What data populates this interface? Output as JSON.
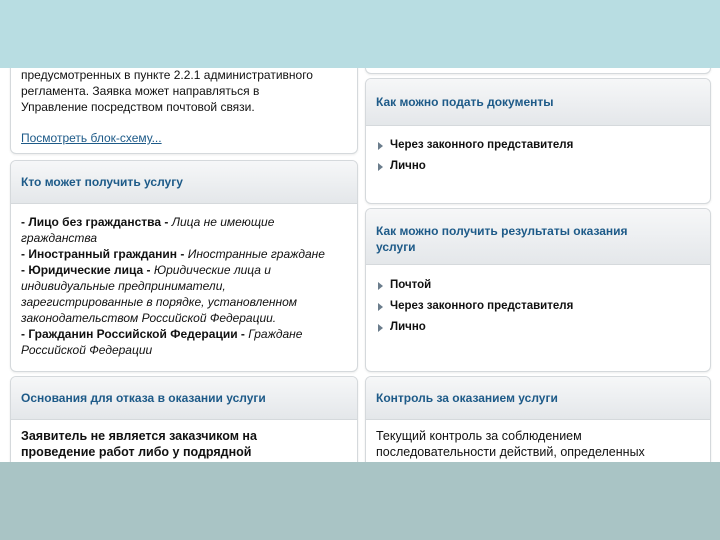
{
  "left_top": {
    "text_lines": [
      "предусмотренных в пункте 2.2.1 административного",
      "регламента. Заявка может направляться в",
      "Управление посредством почтовой связи."
    ],
    "link": "Посмотреть блок-схему..."
  },
  "who": {
    "title": "Кто может получить услугу",
    "lines": [
      {
        "b": "- Лицо без гражданства - ",
        "i": "Лица не имеющие"
      },
      {
        "b": "",
        "i": "гражданства"
      },
      {
        "b": "- Иностранный гражданин - ",
        "i": "Иностранные граждане"
      },
      {
        "b": "- Юридические лица - ",
        "i": "Юридические лица и"
      },
      {
        "b": "",
        "i": "индивидуальные предприниматели,"
      },
      {
        "b": "",
        "i": "зарегистрированные в порядке, установленном"
      },
      {
        "b": "",
        "i": "законодательством Российской Федерации."
      },
      {
        "b": "- Гражданин Российской Федерации - ",
        "i": "Граждане"
      },
      {
        "b": "",
        "i": "Российской Федерации"
      }
    ]
  },
  "refusal": {
    "title": "Основания для отказа в оказании услуги",
    "lines": [
      "Заявитель не является заказчиком на",
      "проведение работ либо у подрядной"
    ]
  },
  "submit": {
    "title": "Как можно подать документы",
    "items": [
      "Через законного представителя",
      "Лично"
    ]
  },
  "results": {
    "title_lines": [
      "Как можно получить результаты оказания",
      "услуги"
    ],
    "items": [
      "Почтой",
      "Через законного представителя",
      "Лично"
    ]
  },
  "control": {
    "title": "Контроль за оказанием услуги",
    "lines": [
      "Текущий контроль за соблюдением",
      "последовательности действий, определенных"
    ]
  }
}
